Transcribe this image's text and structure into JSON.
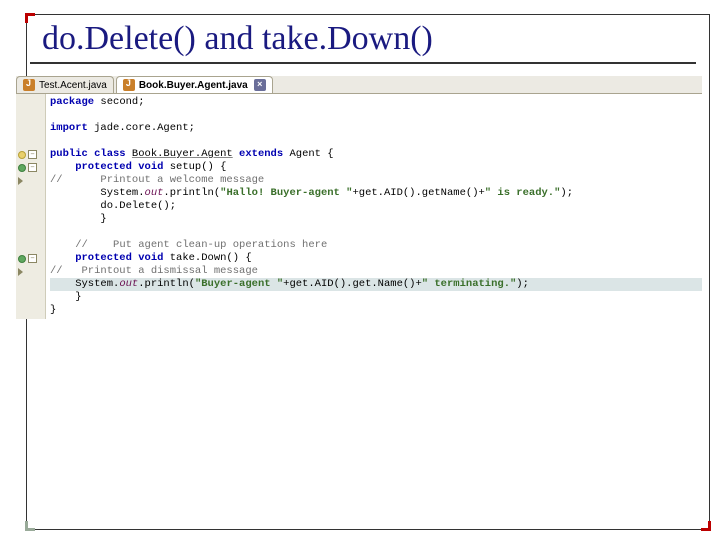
{
  "title": "do.Delete() and take.Down()",
  "tabs": {
    "left": "Test.Acent.java",
    "active": "Book.Buyer.Agent.java",
    "close": "×"
  },
  "gutter": {
    "minus": "–"
  },
  "code": {
    "l1a": "package",
    "l1b": " second;",
    "l3a": "import",
    "l3b": " jade.core.Agent;",
    "l5a": "public class ",
    "l5b": "Book.Buyer.Agent",
    "l5c": " extends",
    "l5d": " Agent {",
    "l6a": "    protected void",
    "l6b": " setup() {",
    "l7": "//      Printout a welcome message",
    "l8a": "        System.",
    "l8b": "out",
    "l8c": ".println(",
    "l8d": "\"Hallo! Buyer-agent \"",
    "l8e": "+get.AID().getName()+",
    "l8f": "\" is ready.\"",
    "l8g": ");",
    "l9": "        do.Delete();",
    "l10": "        }",
    "l12a": "    // ",
    "l12b": "   Put agent clean-up operations here",
    "l13a": "    protected void",
    "l13b": " take.Down() {",
    "l14": "//   Printout a dismissal message",
    "l15a": "    System.",
    "l15b": "out",
    "l15c": ".println(",
    "l15d": "\"Buyer-agent \"",
    "l15e": "+get.AID().get.Name()+",
    "l15f": "\" terminating.\"",
    "l15g": ");",
    "l16": "    }",
    "l17": "}"
  }
}
